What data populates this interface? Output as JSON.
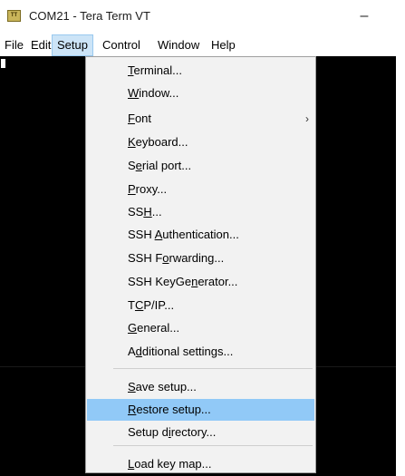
{
  "window": {
    "title": "COM21 - Tera Term VT",
    "icon_text": "TT",
    "minimize_symbol": "–"
  },
  "menubar": {
    "items": [
      "File",
      "Edit",
      "Setup",
      "Control",
      "Window",
      "Help"
    ],
    "active": "Setup"
  },
  "setup_menu": {
    "items": [
      {
        "pre": "",
        "acc": "T",
        "post": "erminal..."
      },
      {
        "pre": "",
        "acc": "W",
        "post": "indow..."
      },
      {
        "pre": "",
        "acc": "F",
        "post": "ont",
        "submenu_arrow": "›"
      },
      {
        "pre": "",
        "acc": "K",
        "post": "eyboard..."
      },
      {
        "pre": "S",
        "acc": "e",
        "post": "rial port..."
      },
      {
        "pre": "",
        "acc": "P",
        "post": "roxy..."
      },
      {
        "pre": "SS",
        "acc": "H",
        "post": "..."
      },
      {
        "pre": "SSH ",
        "acc": "A",
        "post": "uthentication..."
      },
      {
        "pre": "SSH F",
        "acc": "o",
        "post": "rwarding..."
      },
      {
        "pre": "SSH KeyGe",
        "acc": "n",
        "post": "erator..."
      },
      {
        "pre": "T",
        "acc": "C",
        "post": "P/IP..."
      },
      {
        "pre": "",
        "acc": "G",
        "post": "eneral..."
      },
      {
        "pre": "A",
        "acc": "d",
        "post": "ditional settings..."
      },
      {
        "pre": "",
        "acc": "S",
        "post": "ave setup..."
      },
      {
        "pre": "",
        "acc": "R",
        "post": "estore setup...",
        "highlighted": true
      },
      {
        "pre": "Setup d",
        "acc": "i",
        "post": "rectory..."
      },
      {
        "pre": "",
        "acc": "L",
        "post": "oad key map..."
      }
    ]
  },
  "colors": {
    "highlight": "#91c9f7",
    "menu_background": "#f2f2f2",
    "terminal_background": "#000000"
  }
}
